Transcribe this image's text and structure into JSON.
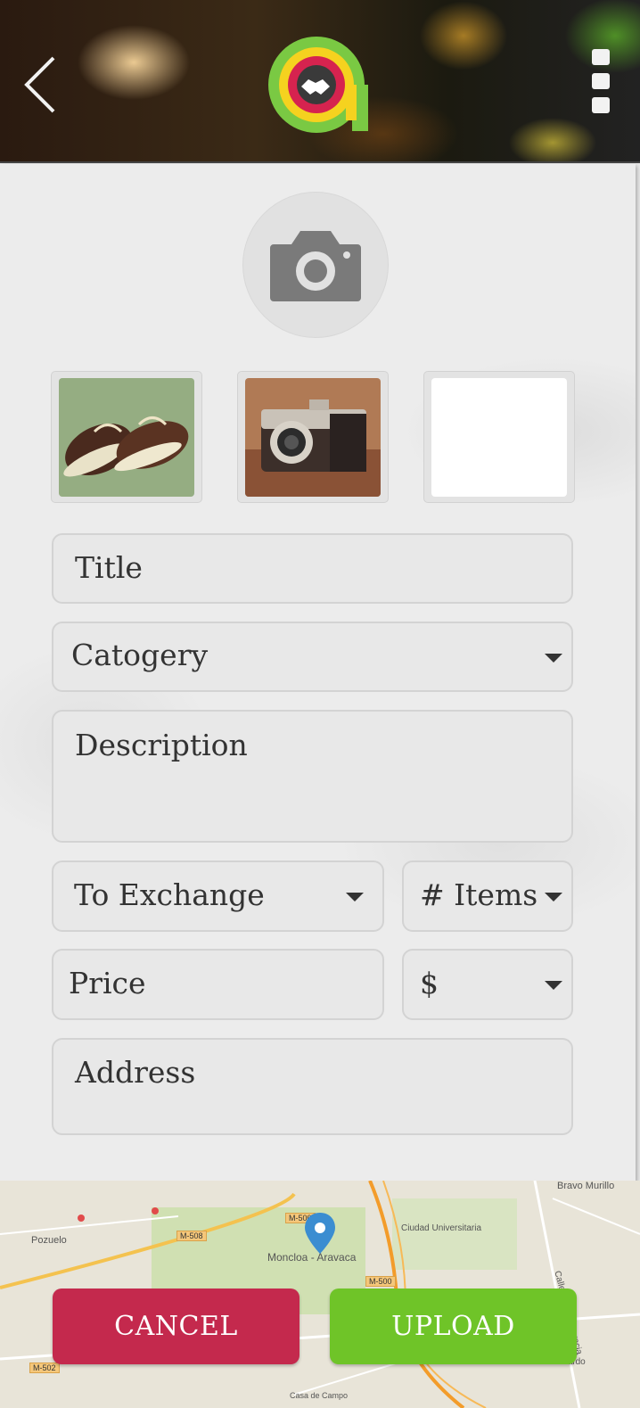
{
  "header": {
    "back_icon": "chevron-left-icon",
    "logo_icon": "handshake-logo-icon",
    "menu_icon": "more-vertical-icon"
  },
  "photo": {
    "camera_icon": "camera-icon",
    "thumbnails": [
      {
        "content": "sneakers-photo"
      },
      {
        "content": "camera-photo"
      },
      {
        "content": "empty"
      }
    ]
  },
  "form": {
    "title_placeholder": "Title",
    "category_placeholder": "Catogery",
    "description_placeholder": "Description",
    "exchange_placeholder": "To Exchange",
    "items_placeholder": "# Items",
    "price_placeholder": "Price",
    "currency_value": "$",
    "address_placeholder": "Address"
  },
  "map": {
    "labels": {
      "pozuelo": "Pozuelo",
      "moncloa": "Moncloa - Aravaca",
      "ciudad": "Ciudad Universitaria",
      "bravo": "Bravo Murillo",
      "calle": "Calle de Sta Engracia",
      "san_bernardo": "San Bernardo",
      "casa": "Casa de Campo"
    },
    "roads": {
      "m508": "M-508",
      "m500a": "M-500",
      "m500b": "M-500",
      "m502": "M-502"
    },
    "pin_icon": "map-pin-icon"
  },
  "actions": {
    "cancel_label": "CANCEL",
    "upload_label": "UPLOAD"
  },
  "colors": {
    "cancel": "#c4294d",
    "upload": "#6fc428"
  }
}
